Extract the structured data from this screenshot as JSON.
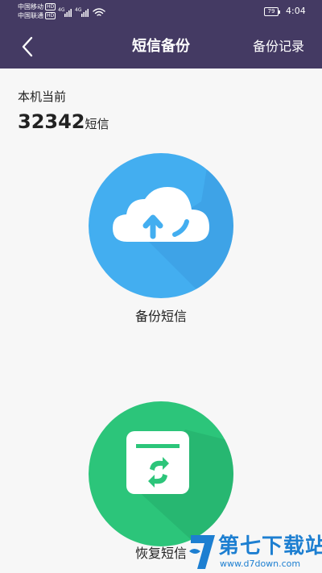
{
  "status_bar": {
    "carrier_1": "中国移动",
    "carrier_2": "中国联通",
    "hd_badge": "HD",
    "network_1": "4G",
    "network_2": "4G",
    "battery": "79",
    "time": "4:04"
  },
  "nav": {
    "back_icon": "chevron-left-icon",
    "title": "短信备份",
    "action_label": "备份记录"
  },
  "count": {
    "label": "本机当前",
    "value": "32342",
    "unit": "短信"
  },
  "backup": {
    "icon": "cloud-upload-icon",
    "label": "备份短信",
    "color": "#43aef0"
  },
  "restore": {
    "icon": "folder-sync-icon",
    "label": "恢复短信",
    "color": "#2cc57a"
  },
  "watermark": {
    "brand": "第七下载站",
    "url": "www.d7down.com"
  },
  "colors": {
    "header": "#443a63",
    "background": "#f7f7f7"
  }
}
